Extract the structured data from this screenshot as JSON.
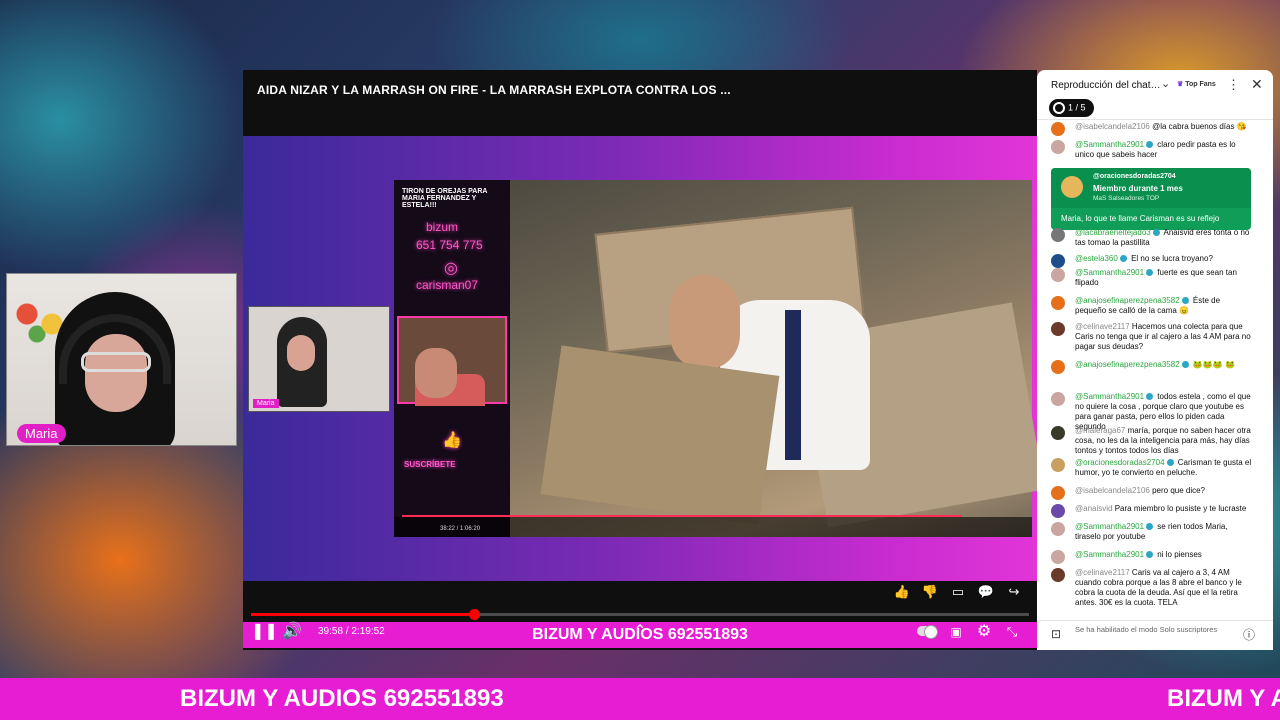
{
  "webcam": {
    "name_tag": "Maria"
  },
  "player": {
    "title": "AIDA NIZAR Y LA MARRASH ON FIRE - LA MARRASH EXPLOTA CONTRA LOS ...",
    "banner": "BIZUM Y AUDIOS 692551893",
    "inner_name_tag": "Maria",
    "time": "39:58 / 2:19:52",
    "progress": 0.287,
    "nested": {
      "top_text": "TIRON DE OREJAS PARA MARIA FERNANDEZ Y ESTELA!!!",
      "bizum_label": "bizum",
      "bizum_number": "651 754 775",
      "instagram": "carisman07",
      "subscribe": "SUSCRÍBETE",
      "time": "38:22 / 1:06:20"
    },
    "icons": [
      "pause-icon",
      "volume-icon",
      "chevron-up-icon",
      "toggle-icon",
      "subtitles-icon",
      "settings-icon",
      "exit-fullscreen-icon",
      "like-icon",
      "dislike-icon",
      "comment-icon",
      "chat-icon",
      "share-icon"
    ]
  },
  "chat": {
    "title": "Reproducción del chat d...",
    "top_fans": "Top Fans",
    "goal": "1 / 5",
    "membership": {
      "name": "@oracionesdoradas2704",
      "title": "Miembro durante 1 mes",
      "level": "MaS Salseadores TOP",
      "message": "Maria, lo que te llame Carisman es su reflejo"
    },
    "messages": [
      {
        "author": "@isabelcandela2106",
        "text": "@la cabra buenos días 😘",
        "member": false,
        "color": "#e6701a"
      },
      {
        "author": "@Sammantha2901",
        "text": "claro pedir pasta es lo unico que sabeis hacer",
        "member": true,
        "color": "#c9a6a0"
      },
      {
        "author": "@lacabraeneltejado3",
        "text": "Anaisvid eres tonta o no tas tomao la pastillita",
        "member": true,
        "color": "#777"
      },
      {
        "author": "@estela360",
        "text": "El no se lucra troyano?",
        "member": true,
        "color": "#1f4d8a"
      },
      {
        "author": "@Sammantha2901",
        "text": "fuerte es que sean tan flipado",
        "member": true,
        "color": "#c9a6a0"
      },
      {
        "author": "@anajosefinaperezpena3582",
        "text": "Éste de pequeño se calló de la cama 😠",
        "member": true,
        "color": "#e6701a"
      },
      {
        "author": "@celinave2117",
        "text": "Hacemos una colecta para que Caris no tenga que ir al cajero a las 4 AM para no pagar sus deudas?",
        "member": false,
        "color": "#6a3a2a"
      },
      {
        "author": "@anajosefinaperezpena3582",
        "text": "🐸🐸🐸 🐸",
        "member": true,
        "color": "#e6701a"
      },
      {
        "author": "@Sammantha2901",
        "text": "todos estela , como el que no quiere la cosa , porque claro que youtube es para ganar pasta, pero ellos lo piden cada segundo",
        "member": true,
        "color": "#c9a6a0"
      },
      {
        "author": "@maleraga67",
        "text": "maría, porque no saben hacer otra cosa, no les da la inteligencia para más, hay días tontos y tontos todos los días",
        "member": false,
        "color": "#3a3a2a"
      },
      {
        "author": "@oracionesdoradas2704",
        "text": "Carisman te gusta el humor, yo te convierto en peluche.",
        "member": true,
        "color": "#c9a060"
      },
      {
        "author": "@isabelcandela2106",
        "text": "pero que dice?",
        "member": false,
        "color": "#e6701a"
      },
      {
        "author": "@anaisvid",
        "text": "Para miembro lo pusiste y te lucraste",
        "member": false,
        "color": "#6a4aa8"
      },
      {
        "author": "@Sammantha2901",
        "text": "se rien todos Maria, tiraselo por youtube",
        "member": true,
        "color": "#c9a6a0"
      },
      {
        "author": "@Sammantha2901",
        "text": "ni lo pienses",
        "member": true,
        "color": "#c9a6a0"
      },
      {
        "author": "@celinave2117",
        "text": "Caris va al cajero a 3, 4 AM cuando cobra porque a las 8 abre el banco y le cobra la cuota de la deuda. Así que el la retira antes. 30€ es la cuota. TELA",
        "member": false,
        "color": "#6a3a2a"
      }
    ],
    "footer": "Se ha habilitado el modo Solo suscriptores"
  },
  "ticker": {
    "text": "BIZUM Y AUDIOS 692551893",
    "text_cut": "BIZUM Y A"
  }
}
